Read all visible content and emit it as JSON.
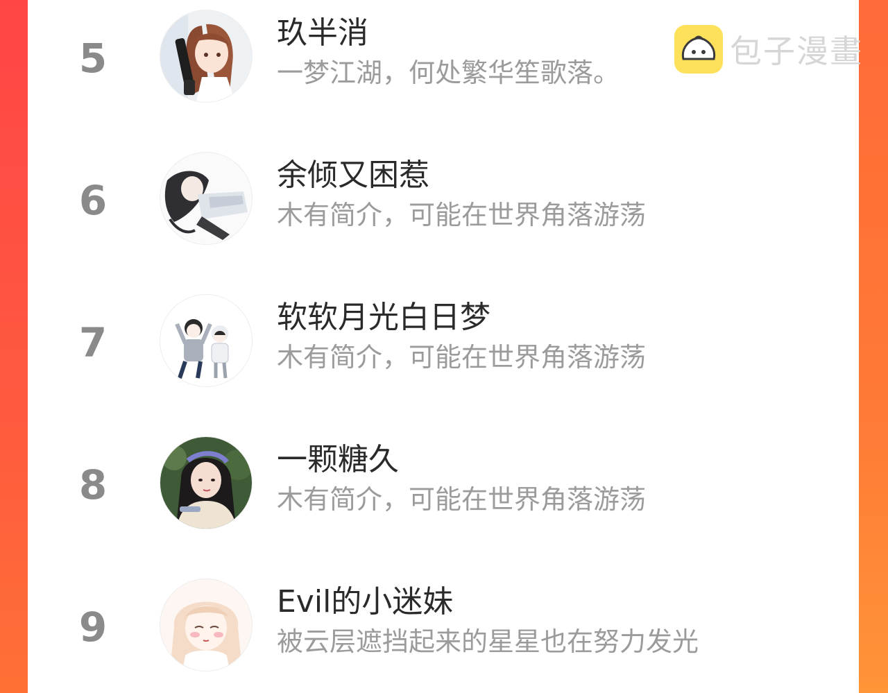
{
  "watermark": {
    "brand_name": "包子漫畫",
    "logo_icon": "steamed-bun-icon",
    "logo_color": "#fde15b"
  },
  "colors": {
    "frame_left": "#ff4546",
    "frame_right": "#ff7a36",
    "rank_number": "#8a8a8a",
    "name_text": "#2a2a2a",
    "bio_text": "#9b9b9b"
  },
  "ranking": [
    {
      "rank": "5",
      "name": "玖半消",
      "bio": "一梦江湖，何处繁华笙歌落。",
      "avatar_icon": "avatar-anime-girl-with-gun-icon"
    },
    {
      "rank": "6",
      "name": "余倾又困惹",
      "bio": "木有简介，可能在世界角落游荡",
      "avatar_icon": "avatar-anime-lying-girl-icon"
    },
    {
      "rank": "7",
      "name": "软软月光白日梦",
      "bio": "木有简介，可能在世界角落游荡",
      "avatar_icon": "avatar-cartoon-couple-icon"
    },
    {
      "rank": "8",
      "name": "一颗糖久",
      "bio": "木有简介，可能在世界角落游荡",
      "avatar_icon": "avatar-photo-girl-icon"
    },
    {
      "rank": "9",
      "name": "Evil的小迷妹",
      "bio": "被云层遮挡起来的星星也在努力发光",
      "avatar_icon": "avatar-anime-pink-girl-icon"
    }
  ]
}
